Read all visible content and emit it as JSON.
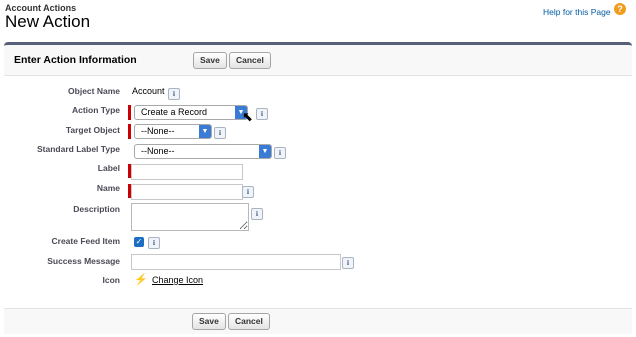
{
  "header": {
    "breadcrumb": "Account Actions",
    "title": "New Action",
    "help_link": "Help for this Page",
    "help_icon": "question-icon"
  },
  "section": {
    "title": "Enter Action Information",
    "save_label": "Save",
    "cancel_label": "Cancel"
  },
  "fields": {
    "object_name": {
      "label": "Object Name",
      "value": "Account"
    },
    "action_type": {
      "label": "Action Type",
      "value": "Create a Record"
    },
    "target_object": {
      "label": "Target Object",
      "value": "--None--"
    },
    "standard_label_type": {
      "label": "Standard Label Type",
      "value": "--None--"
    },
    "label": {
      "label": "Label",
      "value": ""
    },
    "name": {
      "label": "Name",
      "value": ""
    },
    "description": {
      "label": "Description",
      "value": ""
    },
    "create_feed_item": {
      "label": "Create Feed Item",
      "checked": true
    },
    "success_message": {
      "label": "Success Message",
      "value": ""
    },
    "icon": {
      "label": "Icon",
      "change_label": "Change Icon",
      "icon_name": "lightning-bolt-icon"
    }
  },
  "footer": {
    "save_label": "Save",
    "cancel_label": "Cancel"
  },
  "colors": {
    "header_bar": "#56607a",
    "required": "#cc0000",
    "help_icon": "#f09c1e",
    "select_accent": "#3a7bd5",
    "link": "#015ba7"
  },
  "info_glyph": "i",
  "bolt_glyph": "⚡",
  "cursor_glyph": "⬉"
}
